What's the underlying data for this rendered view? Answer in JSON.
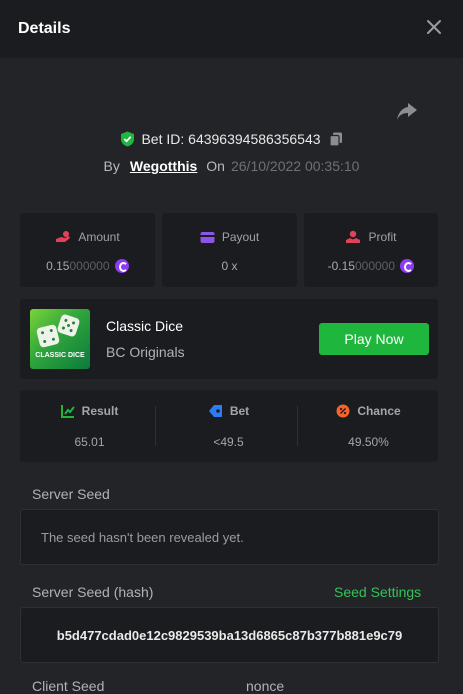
{
  "header": {
    "title": "Details"
  },
  "bet": {
    "id_label": "Bet ID: 64396394586356543",
    "by_label": "By",
    "user": "Wegotthis",
    "on_label": "On",
    "date": "26/10/2022 00:35:10"
  },
  "stats": {
    "amount": {
      "label": "Amount",
      "value": "0.15",
      "zeros": "000000"
    },
    "payout": {
      "label": "Payout",
      "value": "0 x"
    },
    "profit": {
      "label": "Profit",
      "value": "-0.15",
      "zeros": "000000"
    }
  },
  "game": {
    "name": "Classic Dice",
    "provider": "BC Originals",
    "thumb_label": "CLASSIC DICE",
    "play_label": "Play Now"
  },
  "results": {
    "result": {
      "label": "Result",
      "value": "65.01"
    },
    "bet": {
      "label": "Bet",
      "value": "<49.5"
    },
    "chance": {
      "label": "Chance",
      "value": "49.50%"
    }
  },
  "seeds": {
    "server_seed_label": "Server Seed",
    "server_seed_value": "The seed hasn't been revealed yet.",
    "server_hash_label": "Server Seed (hash)",
    "seed_settings_label": "Seed Settings",
    "server_hash_value": "b5d477cdad0e12c9829539ba13d6865c87b377b881e9c79",
    "client_seed_label": "Client Seed",
    "nonce_label": "nonce"
  },
  "colors": {
    "accent_green": "#1fb63e",
    "link_green": "#34c35a",
    "coin_purple": "#8d3cf2",
    "amount_red": "#e0425a",
    "payout_purple": "#8b55e8",
    "bet_blue": "#2f7bf6",
    "chance_orange": "#f4632b"
  },
  "icons": {
    "close": "close-icon",
    "share": "share-icon",
    "verified": "shield-check-icon",
    "copy": "copy-icon",
    "amount": "hand-coin-icon",
    "payout": "wallet-icon",
    "profit": "profit-icon",
    "result": "result-chart-icon",
    "bet": "tag-icon",
    "chance": "percent-icon",
    "currency": "coin-icon"
  }
}
